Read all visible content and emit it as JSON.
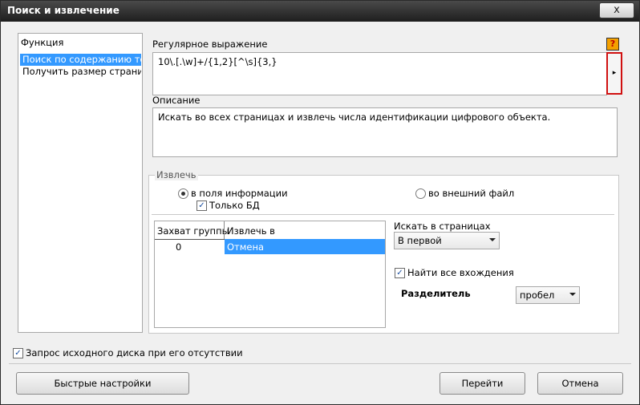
{
  "window": {
    "title": "Поиск и извлечение",
    "close_label": "x"
  },
  "function_panel": {
    "header": "Функция",
    "items": [
      {
        "label": "Поиск по содержанию тек"
      },
      {
        "label": "Получить размер страниц"
      }
    ]
  },
  "regex": {
    "label": "Регулярное выражение",
    "value": "10\\.[.\\w]+/{1,2}[^\\s]{3,}",
    "help_icon": "?",
    "expand_icon": "▸"
  },
  "description": {
    "label": "Описание",
    "value": "Искать во всех страницах и извлечь числа идентификации цифрового объекта."
  },
  "extract": {
    "group_label": "Извлечь",
    "radio_info_fields": "в поля информации",
    "radio_external_file": "во внешний файл",
    "only_db": "Только БД",
    "selected": "в поля информации",
    "only_db_checked": true
  },
  "table": {
    "columns": [
      "Захват группы",
      "Извлечь в"
    ],
    "rows": [
      {
        "group": "0",
        "target": "Отмена"
      }
    ]
  },
  "search_pages": {
    "label": "Искать в страницах",
    "value": "В первой"
  },
  "find_all": {
    "label": "Найти все вхождения",
    "checked": true
  },
  "separator": {
    "label": "Разделитель",
    "value": "пробел"
  },
  "request_disk": {
    "label": "Запрос исходного диска при его отсутствии",
    "checked": true
  },
  "buttons": {
    "quick_settings": "Быстрые настройки",
    "go": "Перейти",
    "cancel": "Отмена"
  },
  "colors": {
    "selection": "#3399ff",
    "highlight_border": "#d01010",
    "help_icon_bg": "#f4a000"
  }
}
